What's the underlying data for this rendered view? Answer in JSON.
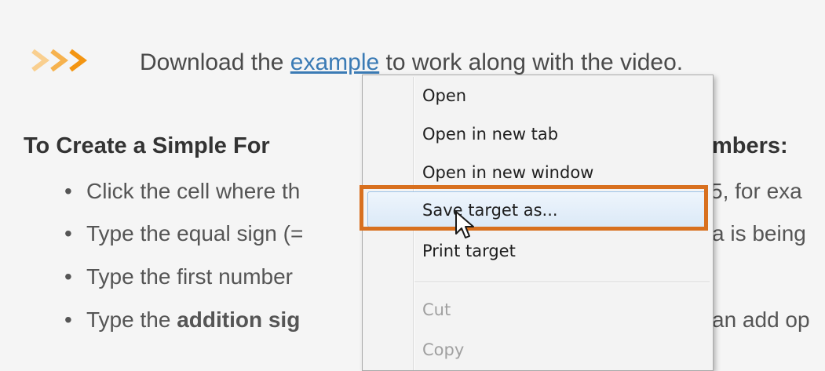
{
  "callout": {
    "before_link": "Download the ",
    "link_text": "example",
    "after_link": " to work along with the video.",
    "chevron_color": "#f5a623"
  },
  "heading": {
    "visible_left": "To Create a Simple For",
    "visible_right": "mbers:"
  },
  "bullets": [
    {
      "left": "Click the cell where th",
      "right": "5, for exa"
    },
    {
      "left": "Type the equal sign (=",
      "right": "a is being"
    },
    {
      "left": "Type the first number",
      "right": ""
    },
    {
      "left_plain": "Type the ",
      "left_bold": "addition sig",
      "right": "an add op"
    }
  ],
  "context_menu": {
    "items": [
      {
        "label": "Open",
        "enabled": true
      },
      {
        "label": "Open in new tab",
        "enabled": true
      },
      {
        "label": "Open in new window",
        "enabled": true
      },
      {
        "label": "Save target as...",
        "enabled": true,
        "highlighted": true
      },
      {
        "label": "Print target",
        "enabled": true
      },
      {
        "label": "Cut",
        "enabled": false
      },
      {
        "label": "Copy",
        "enabled": false
      }
    ],
    "annotation_color": "#d8701f"
  }
}
